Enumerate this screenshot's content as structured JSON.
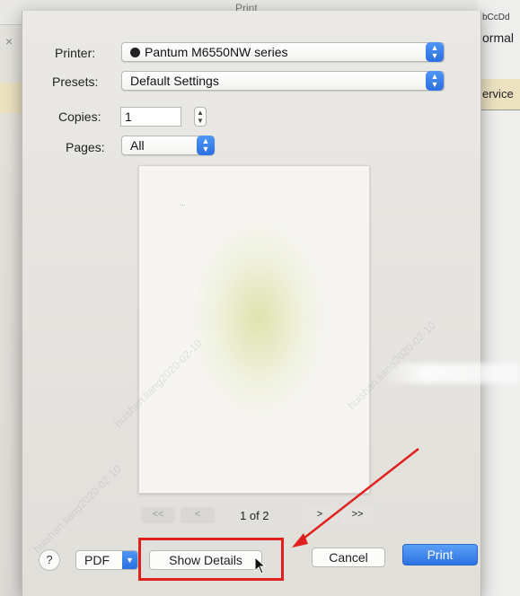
{
  "background": {
    "window_title": "Print",
    "right_text": [
      "bCcDd",
      "ormal",
      "ervice"
    ],
    "close_glyph": "×"
  },
  "sheet": {
    "printer": {
      "label": "Printer:",
      "value": "Pantum M6550NW series"
    },
    "presets": {
      "label": "Presets:",
      "value": "Default Settings"
    },
    "copies": {
      "label": "Copies:",
      "value": "1"
    },
    "pages": {
      "label": "Pages:",
      "value": "All"
    },
    "preview": {
      "page_indicator": "1 of 2",
      "mark": "..."
    },
    "nav": {
      "first": "<<",
      "prev": "<",
      "next": ">",
      "last": ">>"
    },
    "footer": {
      "help": "?",
      "pdf": "PDF",
      "show_details": "Show Details",
      "cancel": "Cancel",
      "print": "Print"
    }
  },
  "watermark_text": "huishan.liang2020-02-10",
  "colors": {
    "accent": "#2d72e2",
    "annotation": "#e0201e"
  },
  "icons": {
    "stepper": "chevron-up-down-icon",
    "printer": "printer-status-icon",
    "cursor": "mouse-pointer-icon"
  }
}
